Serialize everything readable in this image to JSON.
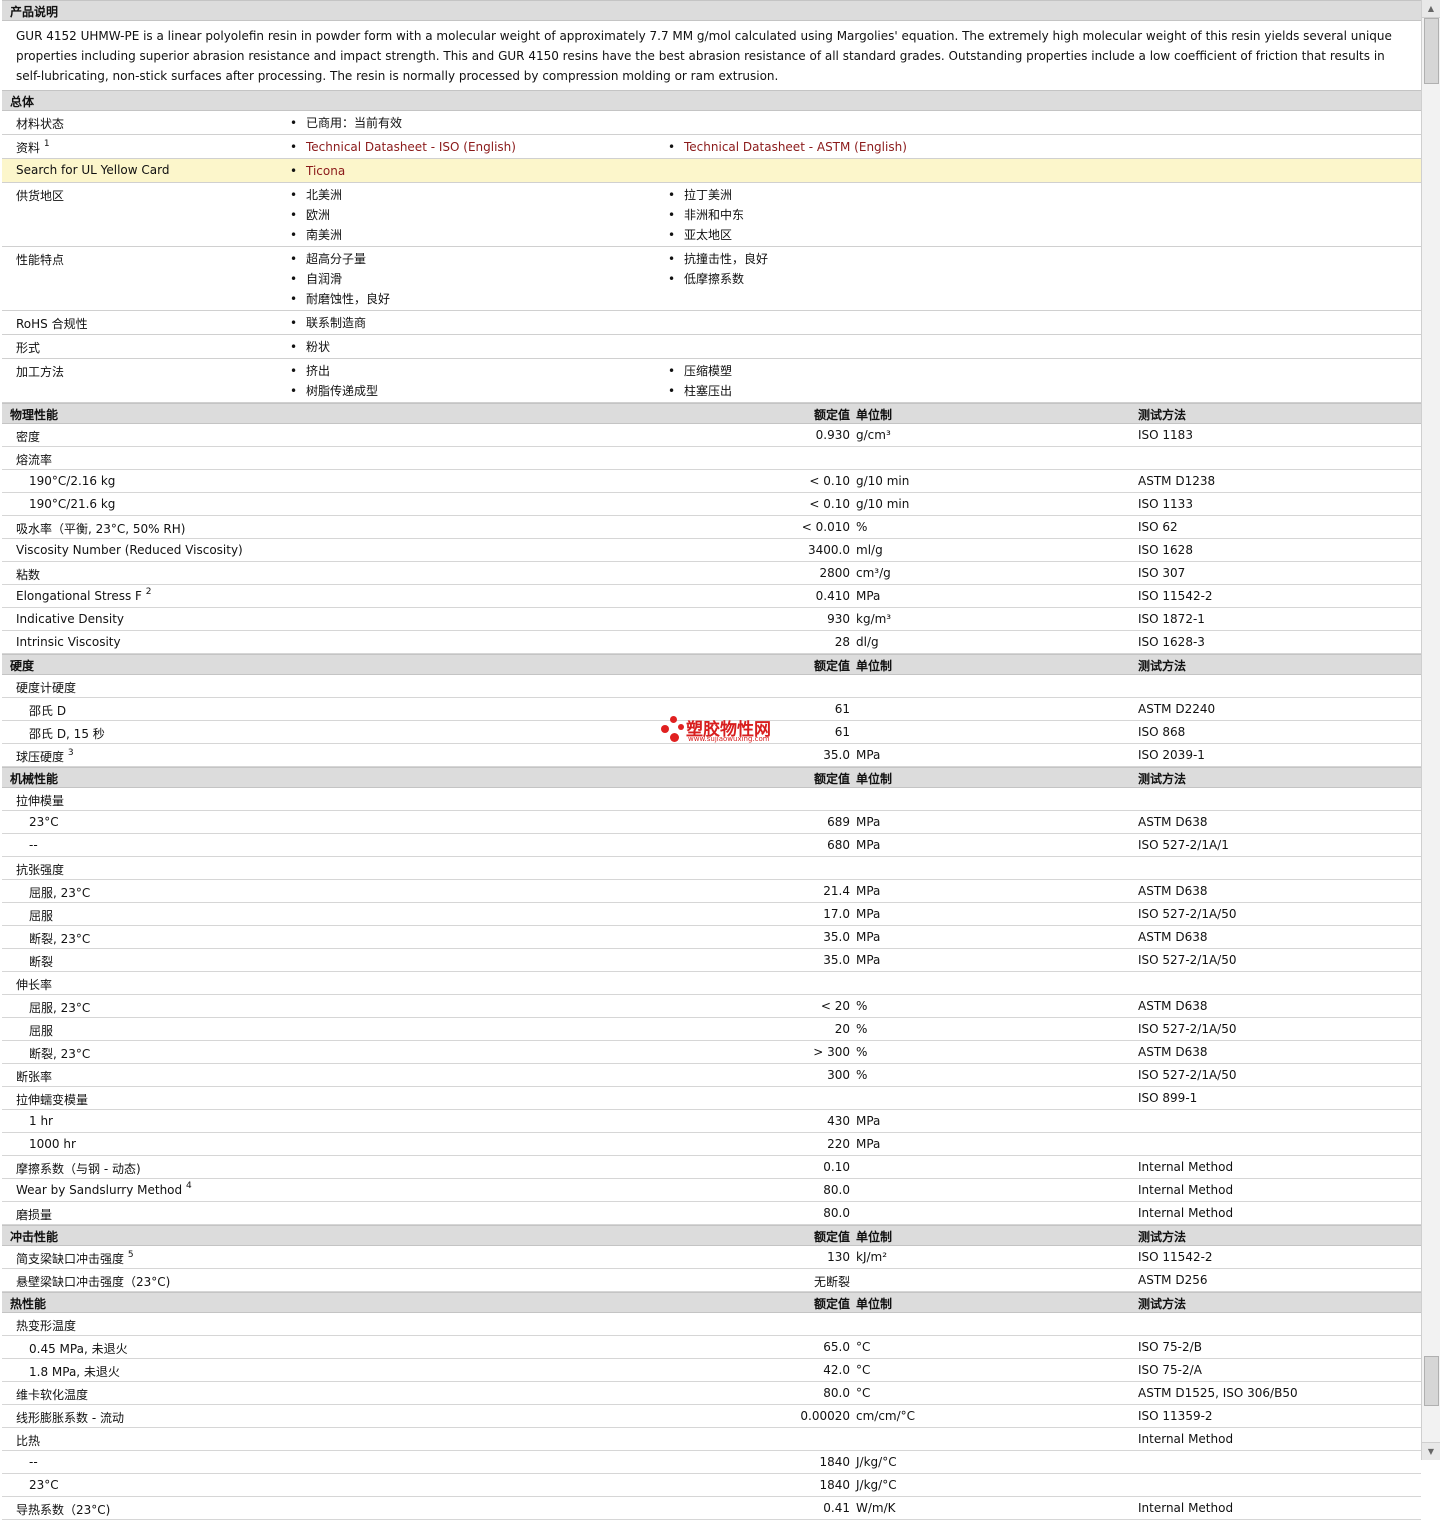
{
  "description": {
    "title": "产品说明",
    "text": "GUR 4152 UHMW-PE is a linear polyolefin resin in powder form with a molecular weight of approximately 7.7 MM g/mol calculated using Margolies' equation. The extremely high molecular weight of this resin yields several unique properties including superior abrasion resistance and impact strength. This and GUR 4150 resins have the best abrasion resistance of all standard grades. Outstanding properties include a low coefficient of friction that results in self-lubricating, non-stick surfaces after processing. The resin is normally processed by compression molding or ram extrusion."
  },
  "general": {
    "title": "总体",
    "rows": [
      {
        "label": "材料状态",
        "sup": "",
        "items": [
          "已商用：当前有效"
        ],
        "link": false,
        "highlight": false
      },
      {
        "label": "资料",
        "sup": "1",
        "items": [
          "Technical Datasheet - ISO (English)",
          "Technical Datasheet - ASTM (English)"
        ],
        "link": true,
        "highlight": false
      },
      {
        "label": "Search for UL Yellow Card",
        "sup": "",
        "items": [
          "Ticona"
        ],
        "link": true,
        "highlight": true
      },
      {
        "label": "供货地区",
        "sup": "",
        "items": [
          "北美洲",
          "拉丁美洲",
          "欧洲",
          "非洲和中东",
          "南美洲",
          "亚太地区"
        ],
        "link": false,
        "highlight": false
      },
      {
        "label": "性能特点",
        "sup": "",
        "items": [
          "超高分子量",
          "抗撞击性，良好",
          "自润滑",
          "低摩擦系数",
          "耐磨蚀性，良好"
        ],
        "link": false,
        "highlight": false
      },
      {
        "label": "RoHS 合规性",
        "sup": "",
        "items": [
          "联系制造商"
        ],
        "link": false,
        "highlight": false
      },
      {
        "label": "形式",
        "sup": "",
        "items": [
          "粉状"
        ],
        "link": false,
        "highlight": false
      },
      {
        "label": "加工方法",
        "sup": "",
        "items": [
          "挤出",
          "压缩模塑",
          "树脂传递成型",
          "柱塞压出"
        ],
        "link": false,
        "highlight": false
      }
    ]
  },
  "column_headers": {
    "value": "额定值",
    "unit": "单位制",
    "method": "测试方法"
  },
  "sections": [
    {
      "title": "物理性能",
      "rows": [
        {
          "label": "密度",
          "sup": "",
          "value": "0.930",
          "unit": "g/cm³",
          "method": "ISO 1183",
          "sub": false
        },
        {
          "label": "熔流率",
          "sup": "",
          "value": "",
          "unit": "",
          "method": "",
          "sub": false
        },
        {
          "label": "190°C/2.16 kg",
          "sup": "",
          "value": "< 0.10",
          "unit": "g/10 min",
          "method": "ASTM D1238",
          "sub": true
        },
        {
          "label": "190°C/21.6 kg",
          "sup": "",
          "value": "< 0.10",
          "unit": "g/10 min",
          "method": "ISO 1133",
          "sub": true
        },
        {
          "label": "吸水率（平衡, 23°C, 50% RH)",
          "sup": "",
          "value": "< 0.010",
          "unit": "%",
          "method": "ISO 62",
          "sub": false
        },
        {
          "label": "Viscosity Number (Reduced Viscosity)",
          "sup": "",
          "value": "3400.0",
          "unit": "ml/g",
          "method": "ISO 1628",
          "sub": false
        },
        {
          "label": "粘数",
          "sup": "",
          "value": "2800",
          "unit": "cm³/g",
          "method": "ISO 307",
          "sub": false
        },
        {
          "label": "Elongational Stress F",
          "sup": "2",
          "value": "0.410",
          "unit": "MPa",
          "method": "ISO 11542-2",
          "sub": false
        },
        {
          "label": "Indicative Density",
          "sup": "",
          "value": "930",
          "unit": "kg/m³",
          "method": "ISO 1872-1",
          "sub": false
        },
        {
          "label": "Intrinsic Viscosity",
          "sup": "",
          "value": "28",
          "unit": "dl/g",
          "method": "ISO 1628-3",
          "sub": false
        }
      ]
    },
    {
      "title": "硬度",
      "rows": [
        {
          "label": "硬度计硬度",
          "sup": "",
          "value": "",
          "unit": "",
          "method": "",
          "sub": false
        },
        {
          "label": "邵氏 D",
          "sup": "",
          "value": "61",
          "unit": "",
          "method": "ASTM D2240",
          "sub": true
        },
        {
          "label": "邵氏 D, 15 秒",
          "sup": "",
          "value": "61",
          "unit": "",
          "method": "ISO 868",
          "sub": true
        },
        {
          "label": "球压硬度",
          "sup": "3",
          "value": "35.0",
          "unit": "MPa",
          "method": "ISO 2039-1",
          "sub": false
        }
      ]
    },
    {
      "title": "机械性能",
      "rows": [
        {
          "label": "拉伸模量",
          "sup": "",
          "value": "",
          "unit": "",
          "method": "",
          "sub": false
        },
        {
          "label": "23°C",
          "sup": "",
          "value": "689",
          "unit": "MPa",
          "method": "ASTM D638",
          "sub": true
        },
        {
          "label": "--",
          "sup": "",
          "value": "680",
          "unit": "MPa",
          "method": "ISO 527-2/1A/1",
          "sub": true
        },
        {
          "label": "抗张强度",
          "sup": "",
          "value": "",
          "unit": "",
          "method": "",
          "sub": false
        },
        {
          "label": "屈服, 23°C",
          "sup": "",
          "value": "21.4",
          "unit": "MPa",
          "method": "ASTM D638",
          "sub": true
        },
        {
          "label": "屈服",
          "sup": "",
          "value": "17.0",
          "unit": "MPa",
          "method": "ISO 527-2/1A/50",
          "sub": true
        },
        {
          "label": "断裂, 23°C",
          "sup": "",
          "value": "35.0",
          "unit": "MPa",
          "method": "ASTM D638",
          "sub": true
        },
        {
          "label": "断裂",
          "sup": "",
          "value": "35.0",
          "unit": "MPa",
          "method": "ISO 527-2/1A/50",
          "sub": true
        },
        {
          "label": "伸长率",
          "sup": "",
          "value": "",
          "unit": "",
          "method": "",
          "sub": false
        },
        {
          "label": "屈服, 23°C",
          "sup": "",
          "value": "< 20",
          "unit": "%",
          "method": "ASTM D638",
          "sub": true
        },
        {
          "label": "屈服",
          "sup": "",
          "value": "20",
          "unit": "%",
          "method": "ISO 527-2/1A/50",
          "sub": true
        },
        {
          "label": "断裂, 23°C",
          "sup": "",
          "value": "> 300",
          "unit": "%",
          "method": "ASTM D638",
          "sub": true
        },
        {
          "label": "断张率",
          "sup": "",
          "value": "300",
          "unit": "%",
          "method": "ISO 527-2/1A/50",
          "sub": false
        },
        {
          "label": "拉伸蠕变模量",
          "sup": "",
          "value": "",
          "unit": "",
          "method": "ISO 899-1",
          "sub": false
        },
        {
          "label": "1 hr",
          "sup": "",
          "value": "430",
          "unit": "MPa",
          "method": "",
          "sub": true
        },
        {
          "label": "1000 hr",
          "sup": "",
          "value": "220",
          "unit": "MPa",
          "method": "",
          "sub": true
        },
        {
          "label": "摩擦系数（与钢 - 动态)",
          "sup": "",
          "value": "0.10",
          "unit": "",
          "method": "Internal Method",
          "sub": false
        },
        {
          "label": "Wear by Sandslurry Method",
          "sup": "4",
          "value": "80.0",
          "unit": "",
          "method": "Internal Method",
          "sub": false
        },
        {
          "label": "磨损量",
          "sup": "",
          "value": "80.0",
          "unit": "",
          "method": "Internal Method",
          "sub": false
        }
      ]
    },
    {
      "title": "冲击性能",
      "rows": [
        {
          "label": "简支梁缺口冲击强度",
          "sup": "5",
          "value": "130",
          "unit": "kJ/m²",
          "method": "ISO 11542-2",
          "sub": false
        },
        {
          "label": "悬壁梁缺口冲击强度（23°C)",
          "sup": "",
          "value": "无断裂",
          "unit": "",
          "method": "ASTM D256",
          "sub": false
        }
      ]
    },
    {
      "title": "热性能",
      "rows": [
        {
          "label": "热变形温度",
          "sup": "",
          "value": "",
          "unit": "",
          "method": "",
          "sub": false
        },
        {
          "label": "0.45 MPa, 未退火",
          "sup": "",
          "value": "65.0",
          "unit": "°C",
          "method": "ISO 75-2/B",
          "sub": true
        },
        {
          "label": "1.8 MPa, 未退火",
          "sup": "",
          "value": "42.0",
          "unit": "°C",
          "method": "ISO 75-2/A",
          "sub": true
        },
        {
          "label": "维卡软化温度",
          "sup": "",
          "value": "80.0",
          "unit": "°C",
          "method": "ASTM D1525, ISO 306/B50",
          "sub": false
        },
        {
          "label": "线形膨胀系数 - 流动",
          "sup": "",
          "value": "0.00020",
          "unit": "cm/cm/°C",
          "method": "ISO 11359-2",
          "sub": false
        },
        {
          "label": "比热",
          "sup": "",
          "value": "",
          "unit": "",
          "method": "Internal Method",
          "sub": false
        },
        {
          "label": "--",
          "sup": "",
          "value": "1840",
          "unit": "J/kg/°C",
          "method": "",
          "sub": true
        },
        {
          "label": "23°C",
          "sup": "",
          "value": "1840",
          "unit": "J/kg/°C",
          "method": "",
          "sub": true
        },
        {
          "label": "导热系数（23°C)",
          "sup": "",
          "value": "0.41",
          "unit": "W/m/K",
          "method": "Internal Method",
          "sub": false
        }
      ]
    }
  ],
  "watermark": {
    "name": "塑胶物性网",
    "url": "www.sujiaowuxing.com",
    "color": "#d81e1e"
  },
  "colors": {
    "link": "#8b1a1a",
    "highlight_row": "#fcf6cb",
    "section_header": "#dcdcdc"
  }
}
